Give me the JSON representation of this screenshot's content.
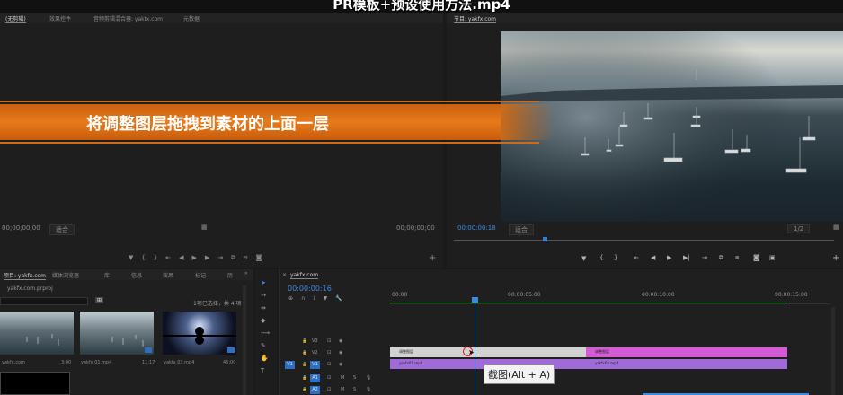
{
  "window": {
    "title": "PR模板+预设使用方法.mp4"
  },
  "source": {
    "tabs": [
      "(无剪辑)",
      "效果控件",
      "音频剪辑混合器: yakfx.com",
      "元数据"
    ],
    "timecode_left": "00;00;00;00",
    "fit_label": "适合",
    "timecode_right": "00;00;00;00"
  },
  "program": {
    "tab": "节目: yakfx.com",
    "timecode": "00:00:00:18",
    "fit": "适合",
    "resolution": "1/2"
  },
  "banner": {
    "text": "将调整图层拖拽到素材的上面一层"
  },
  "project": {
    "tabs": [
      "项目: yakfx.com",
      "媒体浏览器",
      "库",
      "信息",
      "效果",
      "标记",
      "历"
    ],
    "file": "yakfx.com.prproj",
    "selection": "1项已选择，共 4 项",
    "items": [
      {
        "name": "yakfx.com",
        "duration": "3:00"
      },
      {
        "name": "yakfx 01.mp4",
        "duration": "11:17"
      },
      {
        "name": "yakfx 03.mp4",
        "duration": "45:00"
      }
    ]
  },
  "timeline": {
    "tab": "yakfx.com",
    "timecode": "00:00:00:16",
    "ruler": [
      "00:00",
      "00:00:05:00",
      "00:00:10:00",
      "00:00:15:00"
    ],
    "tracks": {
      "v3": "V3",
      "v2": "V2",
      "v1": "V1",
      "a1": "A1",
      "a2": "A2"
    },
    "target_v1": "V1",
    "target_a1": "A1",
    "clips": [
      {
        "name": "调整图层",
        "color": "#cfcfcf"
      },
      {
        "name": "调整图层",
        "color": "#d65ad8"
      },
      {
        "name": "yakfx01.mp4",
        "color": "#a06bd8"
      },
      {
        "name": "yakfx02.mp4",
        "color": "#a06bd8"
      }
    ]
  },
  "tooltip": {
    "text": "截图(Alt + A)"
  },
  "colors": {
    "accent": "#2f7fd6",
    "banner": "#e87a1b",
    "work_area": "#3bb14a"
  }
}
